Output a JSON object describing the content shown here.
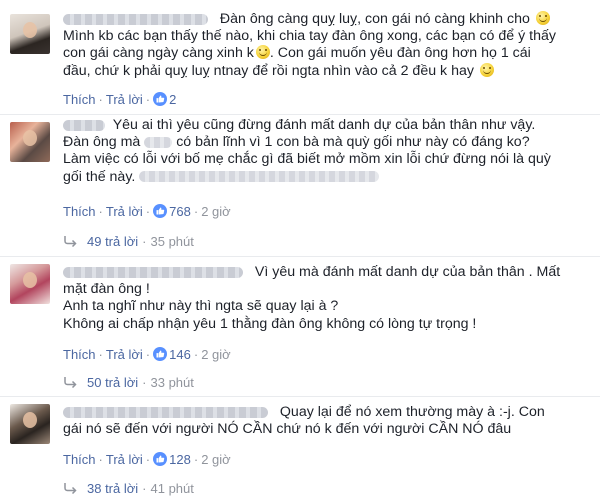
{
  "comments": [
    {
      "lines": [
        "Đàn ông càng quỵ luỵ, con gái nó càng khinh cho",
        "Mình kb các bạn thấy thế nào, khi chia tay đàn ông xong, các bạn có để ý thấy",
        "con gái càng ngày càng xinh k",
        "Con gái muốn yêu đàn ông hơn họ 1 cái",
        "đầu, chứ k phải quỵ luỵ ntnay để rồi ngta nhìn vào cả 2 đều k hay"
      ],
      "actions": {
        "like": "Thích",
        "reply": "Trả lời",
        "likes": "2",
        "time": "",
        "reply_count": "",
        "reply_time": ""
      }
    },
    {
      "lines": [
        "Yêu ai thì yêu cũng đừng đánh mất danh dự của bản thân như vậy.",
        "Đàn ông mà",
        "có bản lĩnh vì 1 con bà mà quỳ gối như này có đáng ko?",
        "Làm việc có lỗi với bố mẹ chắc gì đã biết mở mồm xin lỗi chứ đừng nói là quỳ",
        "gối thế này."
      ],
      "actions": {
        "like": "Thích",
        "reply": "Trả lời",
        "likes": "768",
        "time": "2 giờ"
      },
      "replies": {
        "count": "49 trả lời",
        "time": "35 phút"
      }
    },
    {
      "lines": [
        "Vì yêu mà đánh mất danh dự của bản thân . Mất",
        "mặt đàn ông !",
        "Anh ta nghĩ như này thì ngta sẽ quay lại à ?",
        "Không ai chấp nhận yêu 1 thằng đàn ông không có lòng tự trọng !"
      ],
      "actions": {
        "like": "Thích",
        "reply": "Trả lời",
        "likes": "146",
        "time": "2 giờ"
      },
      "replies": {
        "count": "50 trả lời",
        "time": "33 phút"
      }
    },
    {
      "lines": [
        "Quay lại để nó xem thường mày à :-j. Con",
        "gái nó sẽ đến với người NÓ CẦN chứ nó k đến với người CẦN NÓ đâu"
      ],
      "actions": {
        "like": "Thích",
        "reply": "Trả lời",
        "likes": "128",
        "time": "2 giờ"
      },
      "replies": {
        "count": "38 trả lời",
        "time": "41 phút"
      }
    }
  ],
  "icons": {
    "like": "thumbs-up-icon",
    "reply": "reply-arrow-icon",
    "emoji": "smiley-icon",
    "avatar": "avatar"
  },
  "colors": {
    "link": "#4b67a1",
    "muted": "#90949c",
    "text": "#1d2129",
    "like_blue": "#5890ff"
  }
}
